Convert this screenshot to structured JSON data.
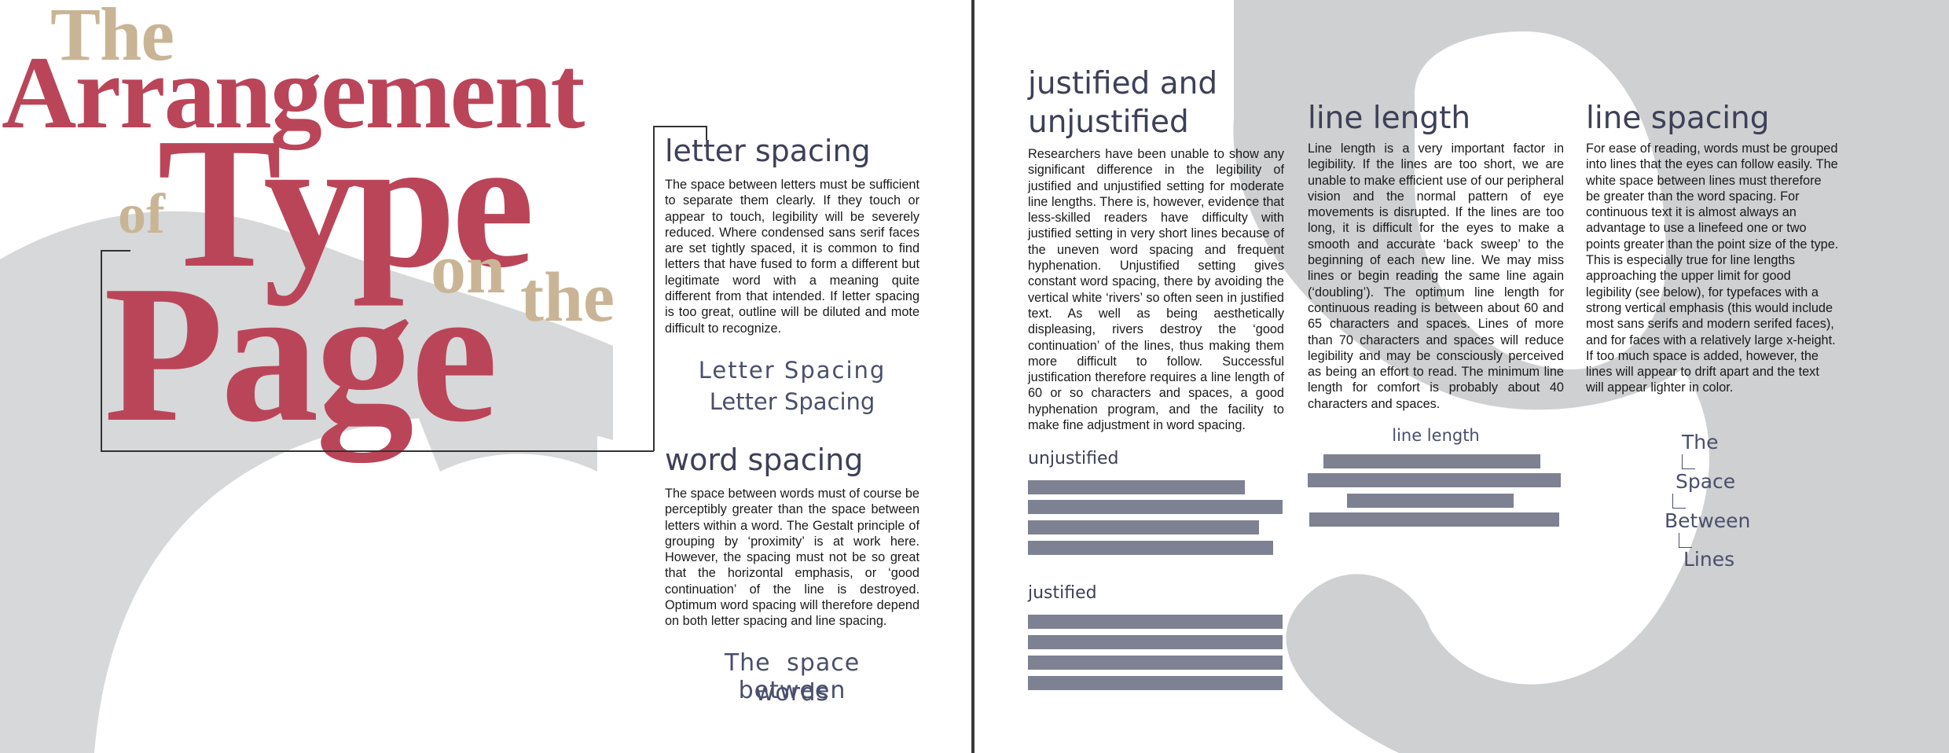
{
  "title": {
    "the": "The",
    "arrangement": "Arrangement",
    "of": "of",
    "type": "Type",
    "on": "on",
    "the2": "the",
    "page": "Page"
  },
  "sections": {
    "letter_spacing": {
      "heading": "letter spacing",
      "body": "The space between letters must be sufficient to separate them clearly. If they touch or appear to touch, legibility will be severely reduced. Where condensed sans serif faces are set tightly spaced, it is common to find letters that have fused to form a different but legitimate word with a meaning quite different from that intended. If letter spacing is too great, outline will be diluted and mote difficult to recognize.",
      "demo_1": "Letter Spacing",
      "demo_2": "Letter Spacing"
    },
    "word_spacing": {
      "heading": "word spacing",
      "body": "The space between words must of course be perceptibly greater than the space between letters within a word. The Gestalt principle of grouping by ‘proximity’ is at work here. However, the spacing must not be so great that the horizontal emphasis, or ‘good continuation’ of the line is destroyed. Optimum word spacing will therefore depend on both letter spacing and line spacing.",
      "demo_1": "The space between",
      "demo_2": "words"
    },
    "justified": {
      "heading_1": "justified and",
      "heading_2": "unjustified",
      "body": "Researchers have been unable to show any significant difference in the legibility of justified and unjustified setting for moderate line lengths. There is, however, evidence that less-skilled readers have difficulty with justified setting in very short lines because of the uneven word spacing and frequent hyphenation. Unjustified setting gives constant word spacing, there by avoiding the vertical white ‘rivers’ so often seen in justified text. As well as being aesthetically displeasing, rivers destroy the ‘good continuation’ of the lines, thus making them more difficult to follow. Successful justification therefore requires a line length of 60 or so characters and spaces, a good hyphenation program, and the facility to make fine adjustment in word spacing.",
      "label_unjustified": "unjustified",
      "label_justified": "justified"
    },
    "line_length": {
      "heading": "line length",
      "body": "Line length is a very important factor in legibility. If the lines are too short, we are unable to make efficient use of our peripheral vision and the normal pattern of eye movements is disrupted. If the lines are too long, it is difficult for the eyes to make a smooth and accurate ‘back sweep’ to the beginning of each new line. We may miss lines or begin reading the same line again (‘doubling’). The optimum line length for continuous reading is between about 60 and 65 characters and spaces. Lines of more than 70 characters and spaces will reduce legibility and may be consciously perceived as being an effort to read. The minimum line length for comfort is probably about 40 characters and spaces.",
      "demo_label": "line length"
    },
    "line_spacing": {
      "heading": "line spacing",
      "body": "For ease of reading, words must be grouped into lines that the eyes can follow easily. The white space between lines must therefore be greater than the word spacing. For continuous text it is almost always an advantage to use a linefeed one or two points greater than the point size of the type. This is especially true for line lengths approaching the upper limit for good legibility (see below), for typefaces with a strong vertical emphasis (this would include most sans serifs and modern serifed faces), and for faces with a relatively large x-height. If too much space is added, however, the lines will appear to drift apart and the text will appear lighter in color.",
      "demo_1": "The",
      "demo_2": "Space",
      "demo_3": "Between",
      "demo_4": "Lines"
    }
  },
  "colors": {
    "title_red": "#ba4559",
    "title_tan": "#c9b596",
    "heading_navy": "#3d4058",
    "bar_gray": "#7d8191",
    "bg_glyph_gray": "#d7d8d9"
  }
}
